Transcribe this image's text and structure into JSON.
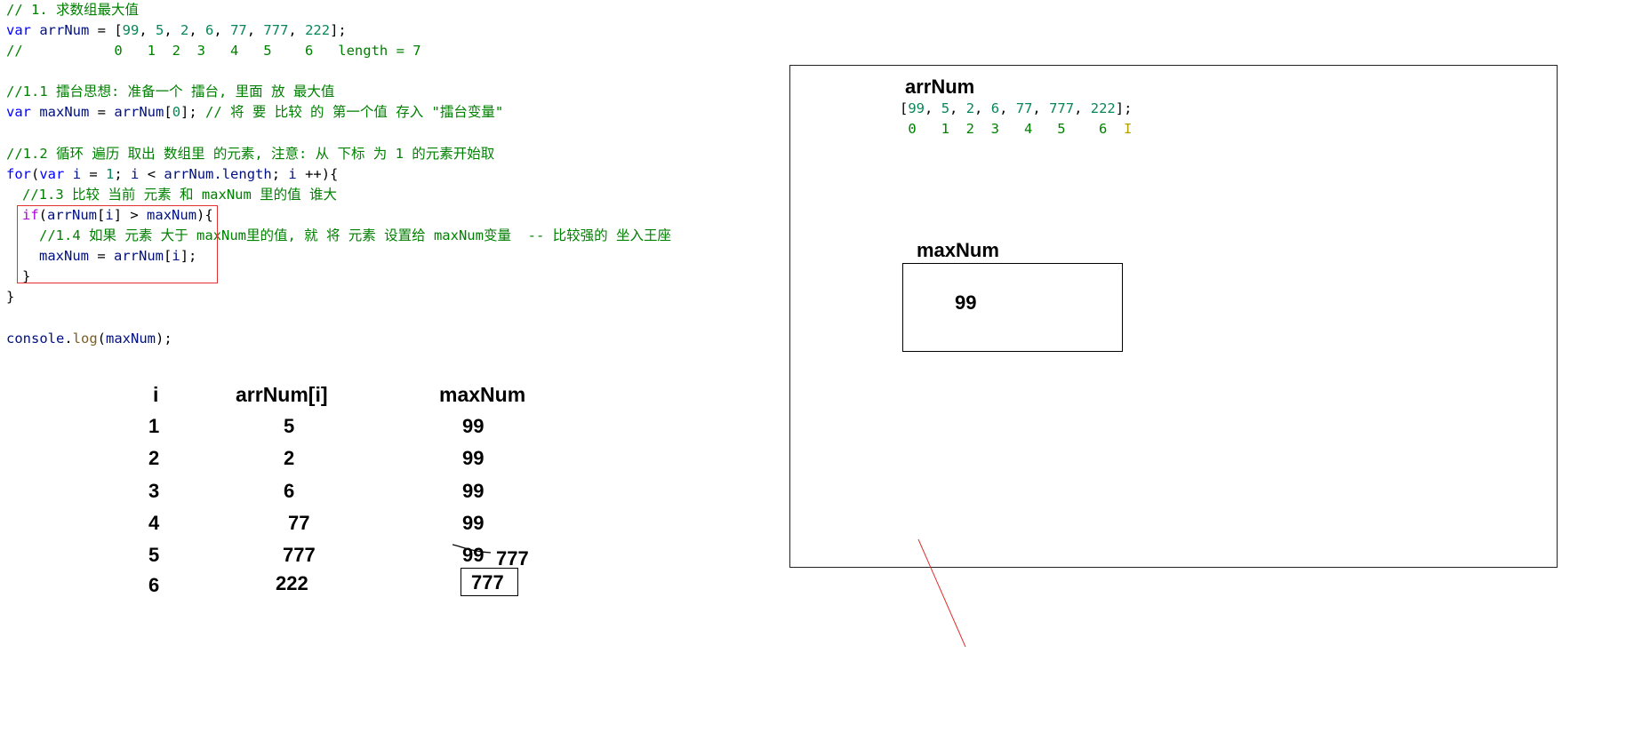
{
  "code": {
    "l01": "// 1. 求数组最大值",
    "l02": {
      "kw": "var",
      "name": "arrNum",
      "eq": " = [",
      "v0": "99",
      "v1": "5",
      "v2": "2",
      "v3": "6",
      "v4": "77",
      "v5": "777",
      "v6": "222",
      "end": "];"
    },
    "l03": "//           0   1  2  3   4   5    6   length = 7",
    "l05": "//1.1 擂台思想: 准备一个 擂台, 里面 放 最大值",
    "l06": {
      "kw": "var",
      "name": "maxNum",
      "eq": " = ",
      "arr": "arrNum",
      "idx": "0",
      "end": "];",
      "comment": "// 将 要 比较 的 第一个值 存入 \"擂台变量\""
    },
    "l08": "//1.2 循环 遍历 取出 数组里 的元素, 注意: 从 下标 为 1 的元素开始取",
    "l09": {
      "for": "for",
      "var": "var",
      "i": "i",
      "one": "1",
      "cond_i": "i",
      "lt": " < ",
      "arr": "arrNum",
      "len": ".length",
      "inc": "i",
      "end": " ++){"
    },
    "l10": "//1.3 比较 当前 元素 和 maxNum 里的值 谁大",
    "l11": {
      "if": "if",
      "arr": "arrNum",
      "i": "i",
      "gt": "] > ",
      "max": "maxNum",
      "end": "){"
    },
    "l12": "//1.4 如果 元素 大于 maxNum里的值, 就 将 元素 设置给 maxNum变量  -- 比较强的 坐入王座",
    "l13": {
      "max": "maxNum",
      "eq": " = ",
      "arr": "arrNum",
      "i": "i",
      "end": "];"
    },
    "l14": "}",
    "l15": "}",
    "l17": {
      "obj": "console",
      "fn": "log",
      "arg": "maxNum",
      "end": ");"
    }
  },
  "trace": {
    "headers": [
      "i",
      "arrNum[i]",
      "maxNum"
    ],
    "rows": [
      [
        "1",
        "5",
        "99"
      ],
      [
        "2",
        "2",
        "99"
      ],
      [
        "3",
        "6",
        "99"
      ],
      [
        "4",
        "77",
        "99"
      ],
      [
        "5",
        "777",
        "99"
      ],
      [
        "6",
        "222",
        "777"
      ]
    ],
    "row5_new_max": "777"
  },
  "panel": {
    "arr_title": "arrNum",
    "arr_values": "[99, 5, 2, 6, 77, 777, 222];",
    "arr_index": " 0   1  2  3   4   5    6  ",
    "arr_index_cursor": "I",
    "max_title": "maxNum",
    "max_value": "99"
  },
  "colors": {
    "comment": "#008000",
    "keyword": "#0000ff",
    "identifier": "#001080",
    "number": "#098658",
    "function": "#795e26",
    "highlight_border": "#e03030",
    "annotation_line": "#e03030"
  }
}
